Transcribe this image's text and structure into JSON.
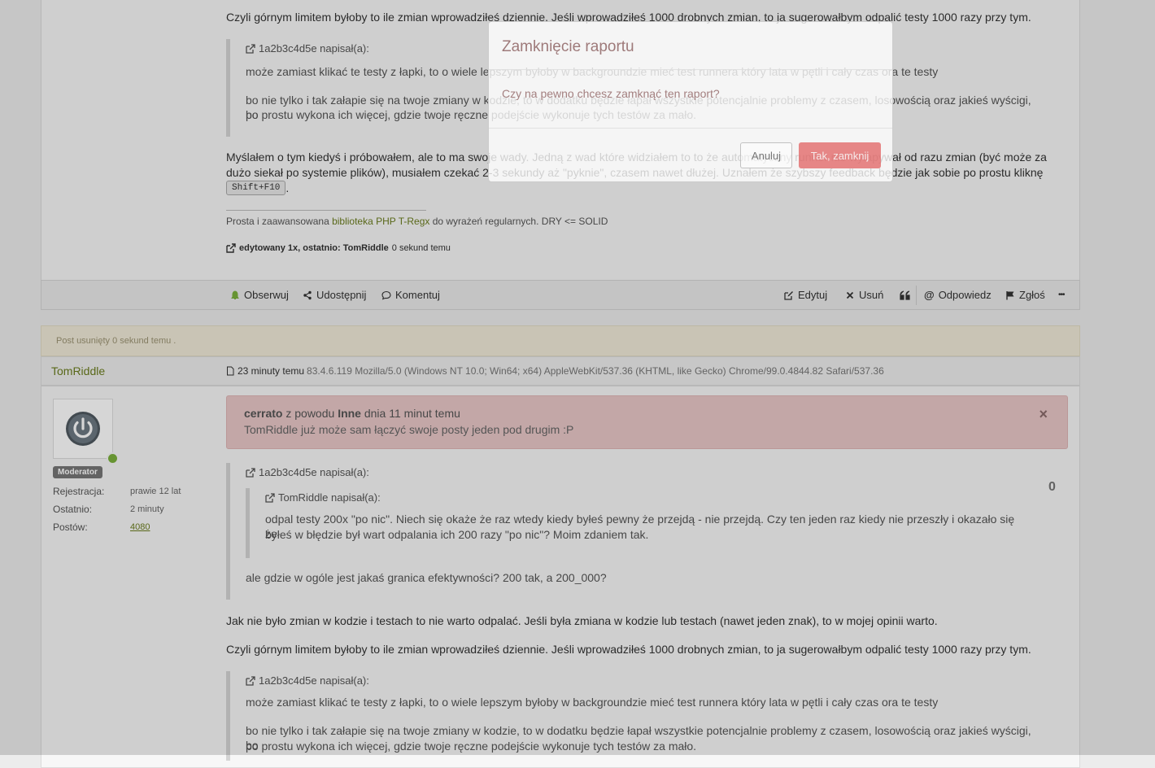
{
  "post1": {
    "p_top": "Czyli górnym limitem byłoby to ile zmian wprowadziłeś dziennie. Jeśli wprowadziłeś 1000 drobnych zmian, to ja sugerowałbym odpalić testy 1000 razy przy tym.",
    "quote": {
      "author": "1a2b3c4d5e napisał(a):",
      "line1": "może zamiast klikać te testy z łapki, to o wiele lepszym byłoby w backgroundzie mieć test runnera który lata w pętli i cały czas ora te testy",
      "line2a": "bo nie tylko i tak załapie się na twoje zmiany w kodzie, to w dodatku będzie łapał wszystkie potencjalnie problemy z czasem, losowością oraz jakieś wyścigi, bo",
      "line2b": "po prostu wykona ich więcej, gdzie twoje ręczne podejście wykonuje tych testów za mało."
    },
    "p_mid1": "Myślałem o tym kiedyś i próbowałem, ale to ma swoje wady. Jedną z wad które widziałem to to że automatyczny runner nie wyłapywał od razu zmian (być może za",
    "p_mid2": "dużo siekał po systemie plików), musiałem czekać 2-3 sekundy aż \"pyknie\", czasem nawet dłużej. Uznałem że szybszy feedback będzie jak sobie po prostu kliknę",
    "kbd": "Shift+F10",
    "kbd_after": ".",
    "sig_before": "Prosta i zaawansowana ",
    "sig_link": "biblioteka PHP T-Regx",
    "sig_after": " do wyrażeń regularnych. DRY <= SOLID",
    "edited_label": "edytowany 1x, ostatnio: TomRiddle",
    "edited_time": "0 sekund temu"
  },
  "toolbar": {
    "follow": "Obserwuj",
    "share": "Udostępnij",
    "comment": "Komentuj",
    "edit": "Edytuj",
    "delete": "Usuń",
    "reply": "Odpowiedz",
    "report": "Zgłoś",
    "more": "•••"
  },
  "post2": {
    "deleted_note": "Post usunięty 0 sekund temu .",
    "author": "TomRiddle",
    "time": "23 minuty temu",
    "useragent": "83.4.6.119 Mozilla/5.0 (Windows NT 10.0; Win64; x64) AppleWebKit/537.36 (KHTML, like Gecko) Chrome/99.0.4844.82 Safari/537.36",
    "role": "Moderator",
    "meta": [
      {
        "label": "Rejestracja:",
        "value": "prawie 12 lat"
      },
      {
        "label": "Ostatnio:",
        "value": "2 minuty"
      },
      {
        "label": "Postów:",
        "value": "4080"
      }
    ],
    "alert_user": "cerrato",
    "alert_mid": " z powodu ",
    "alert_reason": "Inne",
    "alert_when": " dnia 11 minut temu",
    "alert_text": "TomRiddle już może sam łączyć swoje posty jeden pod drugim :P",
    "alert_close": "×",
    "votes": "0",
    "quote": {
      "author": "1a2b3c4d5e napisał(a):",
      "inner_author": "TomRiddle napisał(a):",
      "inner_line1": "odpal testy 200x \"po nic\". Niech się okaże że raz wtedy kiedy byłeś pewny że przejdą - nie przejdą. Czy ten jeden raz kiedy nie przeszły i okazało się że",
      "inner_line2": "byłeś w błędzie był wart odpalania ich 200 razy \"po nic\"? Moim zdaniem tak.",
      "text": "ale gdzie w ogóle jest jakaś granica efektywności? 200 tak, a 200_000?"
    },
    "p1": "Jak nie było zmian w kodzie i testach to nie warto odpalać. Jeśli była zmiana w kodzie lub testach (nawet jeden znak), to w mojej opinii warto.",
    "p2": "Czyli górnym limitem byłoby to ile zmian wprowadziłeś dziennie. Jeśli wprowadziłeś 1000 drobnych zmian, to ja sugerowałbym odpalić testy 1000 razy przy tym.",
    "quote2": {
      "author": "1a2b3c4d5e napisał(a):",
      "line1": "może zamiast klikać te testy z łapki, to o wiele lepszym byłoby w backgroundzie mieć test runnera który lata w pętli i cały czas ora te testy",
      "line2a": "bo nie tylko i tak załapie się na twoje zmiany w kodzie, to w dodatku będzie łapał wszystkie potencjalnie problemy z czasem, losowością oraz jakieś wyścigi, bo",
      "line2b": "po prostu wykona ich więcej, gdzie twoje ręczne podejście wykonuje tych testów za mało."
    }
  },
  "modal": {
    "title": "Zamknięcie raportu",
    "body": "Czy na pewno chcesz zamknąć ten raport?",
    "cancel": "Anuluj",
    "confirm": "Tak, zamknij"
  },
  "colors": {
    "accent": "#6b7d1e",
    "danger": "#e06060",
    "online": "#7bb13c"
  }
}
